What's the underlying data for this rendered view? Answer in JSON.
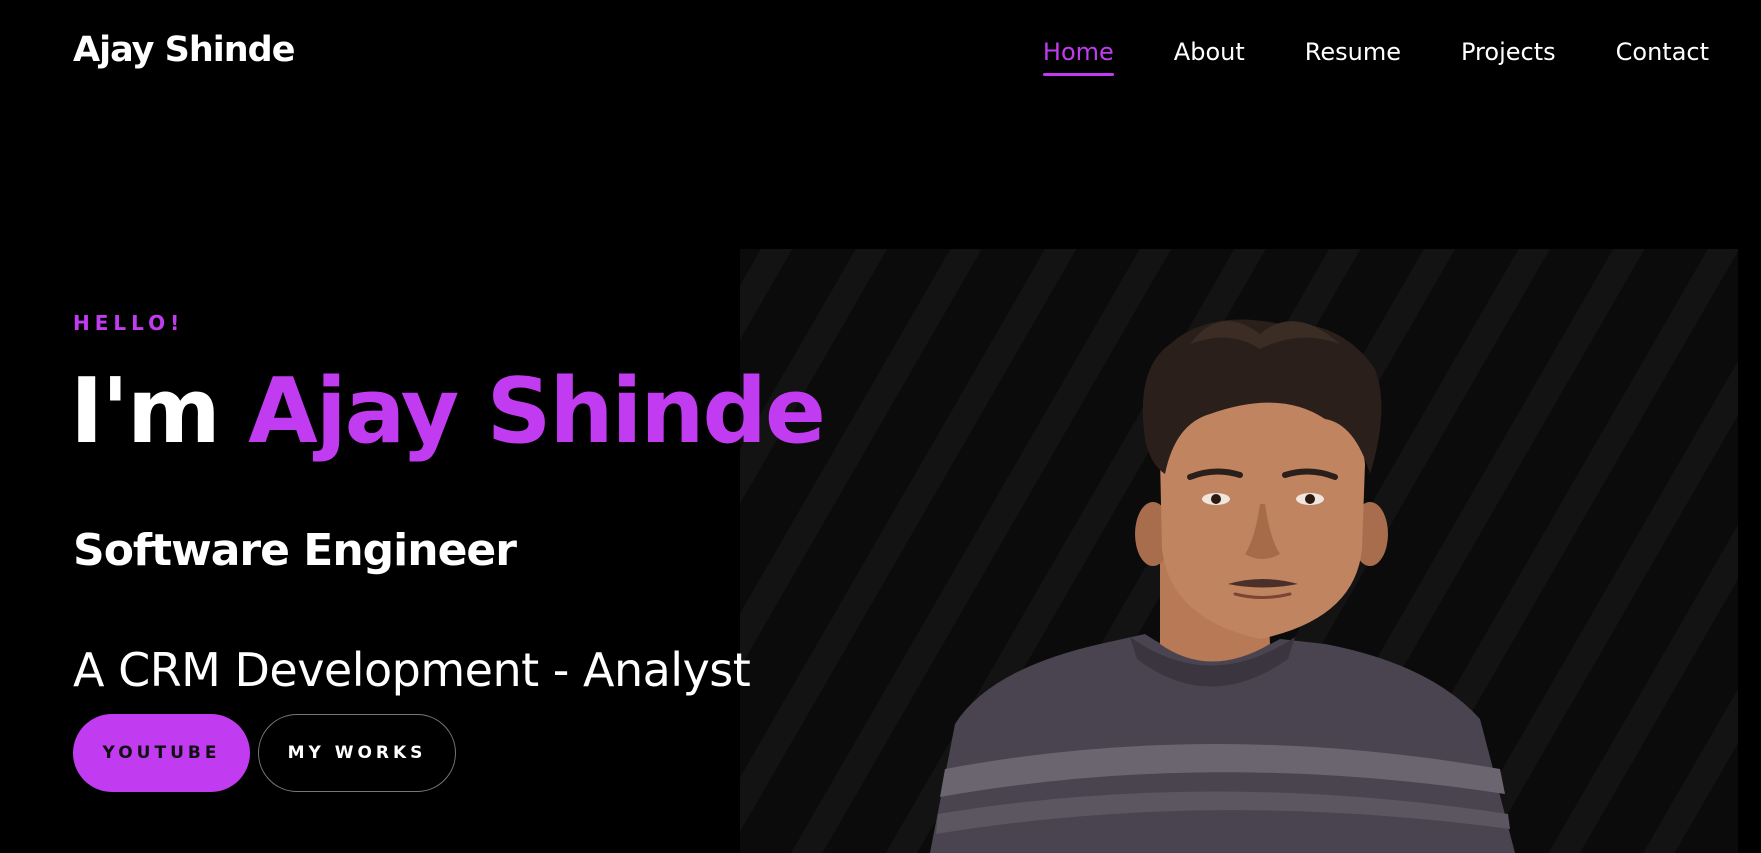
{
  "brand": {
    "name": "Ajay Shinde"
  },
  "nav": {
    "items": [
      {
        "label": "Home",
        "active": true
      },
      {
        "label": "About",
        "active": false
      },
      {
        "label": "Resume",
        "active": false
      },
      {
        "label": "Projects",
        "active": false
      },
      {
        "label": "Contact",
        "active": false
      }
    ]
  },
  "hero": {
    "greeting": "HELLO!",
    "intro": "I'm",
    "name": "Ajay Shinde",
    "role": "Software Engineer",
    "tagline": "A CRM Development - Analyst",
    "buttons": {
      "youtube": "YOUTUBE",
      "works": "MY WORKS"
    }
  },
  "colors": {
    "accent": "#c13cf0",
    "background": "#000000",
    "text": "#ffffff"
  },
  "icons": {
    "portrait": "profile-photo"
  }
}
